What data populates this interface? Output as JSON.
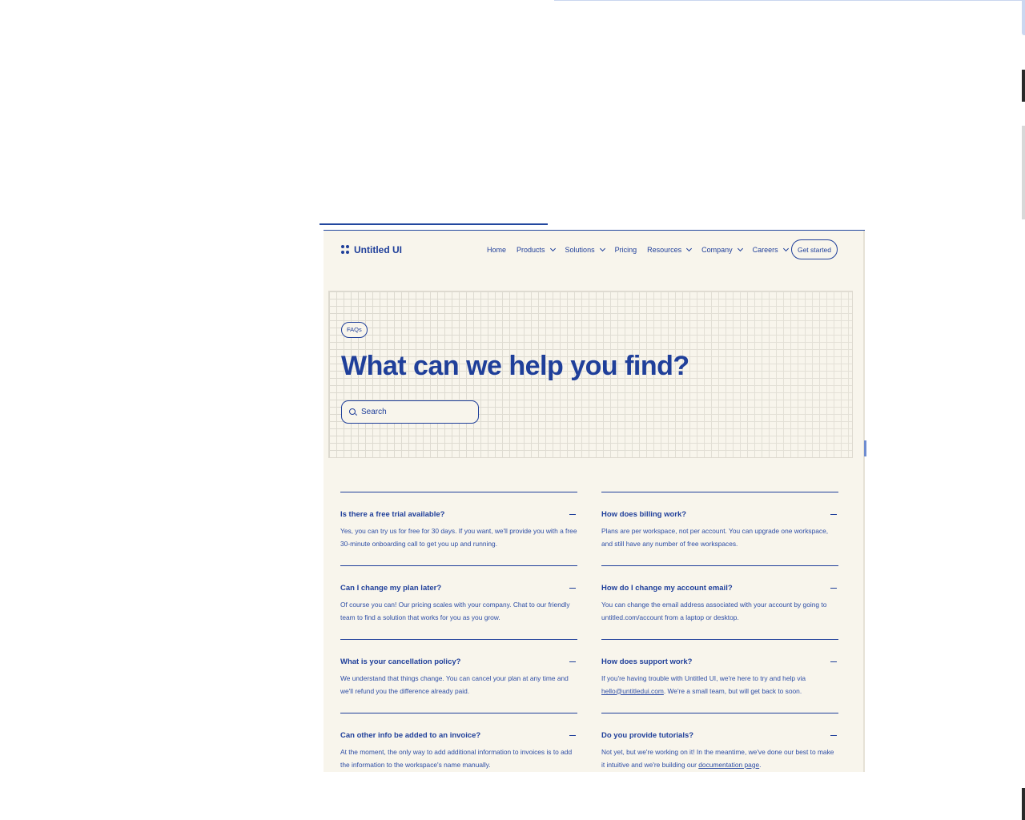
{
  "brand": {
    "name": "Untitled UI"
  },
  "nav": {
    "links": [
      {
        "label": "Home",
        "dropdown": false
      },
      {
        "label": "Products",
        "dropdown": true
      },
      {
        "label": "Solutions",
        "dropdown": true
      },
      {
        "label": "Pricing",
        "dropdown": false
      },
      {
        "label": "Resources",
        "dropdown": true
      },
      {
        "label": "Company",
        "dropdown": true
      },
      {
        "label": "Careers",
        "dropdown": true
      }
    ],
    "cta": "Get started"
  },
  "hero": {
    "badge": "FAQs",
    "title": "What can we help you find?",
    "search_placeholder": "Search"
  },
  "faqs": {
    "left": [
      {
        "question": "Is there a free trial available?",
        "answer": "Yes, you can try us for free for 30 days. If you want, we'll provide you with a free 30-minute onboarding call to get you up and running."
      },
      {
        "question": "Can I change my plan later?",
        "answer": "Of course you can! Our pricing scales with your company. Chat to our friendly team to find a solution that works for you as you grow."
      },
      {
        "question": "What is your cancellation policy?",
        "answer": "We understand that things change. You can cancel your plan at any time and we'll refund you the difference already paid."
      },
      {
        "question": "Can other info be added to an invoice?",
        "answer": "At the moment, the only way to add additional information to invoices is to add the information to the workspace's name manually."
      }
    ],
    "right": [
      {
        "question": "How does billing work?",
        "answer": "Plans are per workspace, not per account. You can upgrade one workspace, and still have any number of free workspaces."
      },
      {
        "question": "How do I change my account email?",
        "answer": "You can change the email address associated with your account by going to untitled.com/account from a laptop or desktop."
      },
      {
        "question": "How does support work?",
        "answer_pre": "If you're having trouble with Untitled UI, we're here to try and help via ",
        "answer_link": "hello@untitledui.com",
        "answer_post": ". We're a small team, but will get back to soon."
      },
      {
        "question": "Do you provide tutorials?",
        "answer_pre": "Not yet, but we're working on it! In the meantime, we've done our best to make it intuitive and we're building our ",
        "answer_link": "documentation page",
        "answer_post": "."
      }
    ]
  },
  "colors": {
    "accent": "#1f3f9a",
    "background": "#f8f5ec"
  }
}
